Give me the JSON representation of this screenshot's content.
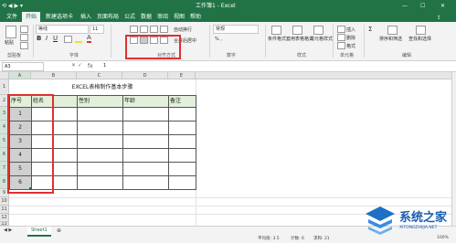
{
  "window": {
    "title": "工作簿1 - Excel"
  },
  "tabs": [
    "文件",
    "开始",
    "新建选项卡",
    "插入",
    "页面布局",
    "公式",
    "数据",
    "审阅",
    "视图",
    "帮助"
  ],
  "ribbon": {
    "paste": "粘贴",
    "clipboard": "剪贴板",
    "font_name": "等线",
    "font_size": "11",
    "font_group": "字体",
    "wrap_text": "自动换行",
    "merge_center": "合并后居中",
    "alignment_group": "对齐方式",
    "number_format": "常规",
    "number_group": "数字",
    "cond_format": "条件格式",
    "table_format": "套用表格格式",
    "cell_style": "单元格样式",
    "styles_group": "样式",
    "insert": "插入",
    "delete": "删除",
    "format": "格式",
    "cells_group": "单元格",
    "sort_filter": "排序和筛选",
    "find_select": "查找和选择",
    "editing_group": "编辑"
  },
  "formula_bar": {
    "name_box": "A3",
    "fx": "fx",
    "value": "1"
  },
  "columns": [
    "A",
    "B",
    "C",
    "D",
    "E"
  ],
  "rows": [
    "1",
    "2",
    "3",
    "4",
    "5",
    "6",
    "7",
    "8",
    "9",
    "10",
    "11",
    "12",
    "13"
  ],
  "sheet": {
    "title": "EXCEL表格制作基本步骤",
    "headers": [
      "序号",
      "姓名",
      "性别",
      "年龄",
      "备注"
    ],
    "seq": [
      "1",
      "2",
      "3",
      "4",
      "5",
      "6"
    ]
  },
  "status": {
    "tab": "Sheet1",
    "average": "平均值: 3.5",
    "count": "计数: 6",
    "sum": "求和: 21",
    "zoom": "100%"
  },
  "watermark": {
    "brand": "系统之家",
    "url": "XITONGZHIJIA.NET"
  },
  "colors": {
    "excel_green": "#217346",
    "highlight_red": "#e03030"
  }
}
